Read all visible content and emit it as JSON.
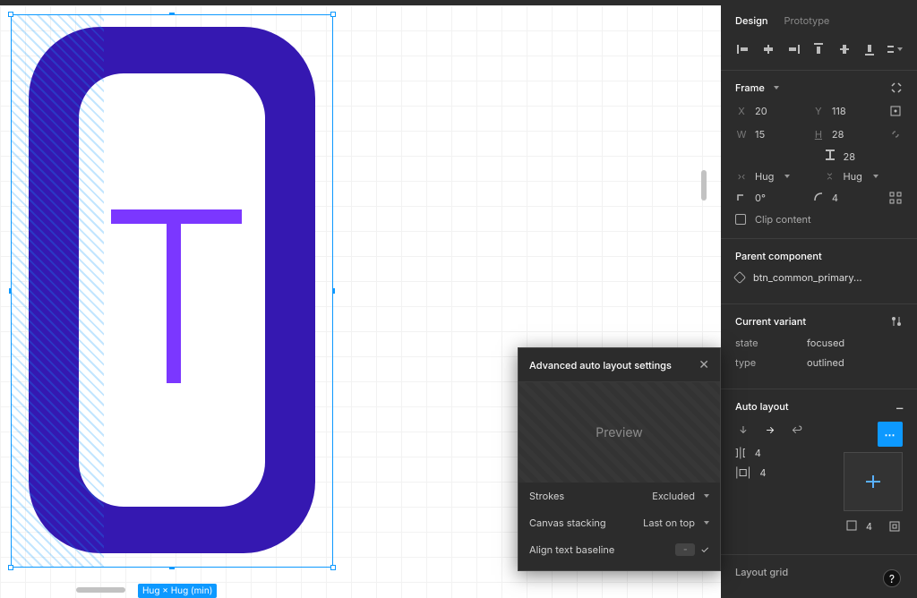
{
  "tabs": {
    "design": "Design",
    "prototype": "Prototype"
  },
  "frame": {
    "title": "Frame",
    "x_label": "X",
    "x": "20",
    "y_label": "Y",
    "y": "118",
    "w_label": "W",
    "w": "15",
    "h_label": "H",
    "h": "28",
    "line_h": "28",
    "resize_h": "Hug",
    "resize_v": "Hug",
    "rotation": "0°",
    "radius": "4",
    "clip_content": "Clip content"
  },
  "parent": {
    "title": "Parent component",
    "name": "btn_common_primary..."
  },
  "variant": {
    "title": "Current variant",
    "state_k": "state",
    "state_v": "focused",
    "type_k": "type",
    "type_v": "outlined"
  },
  "auto_layout": {
    "title": "Auto layout",
    "gap_h": "4",
    "gap_v": "4",
    "pad": "4"
  },
  "layout_grid": {
    "title": "Layout grid"
  },
  "popup": {
    "title": "Advanced auto layout settings",
    "preview": "Preview",
    "strokes_k": "Strokes",
    "strokes_v": "Excluded",
    "stacking_k": "Canvas stacking",
    "stacking_v": "Last on top",
    "align_k": "Align text baseline",
    "align_v": "-"
  },
  "canvas": {
    "size_label": "Hug × Hug (min)"
  }
}
